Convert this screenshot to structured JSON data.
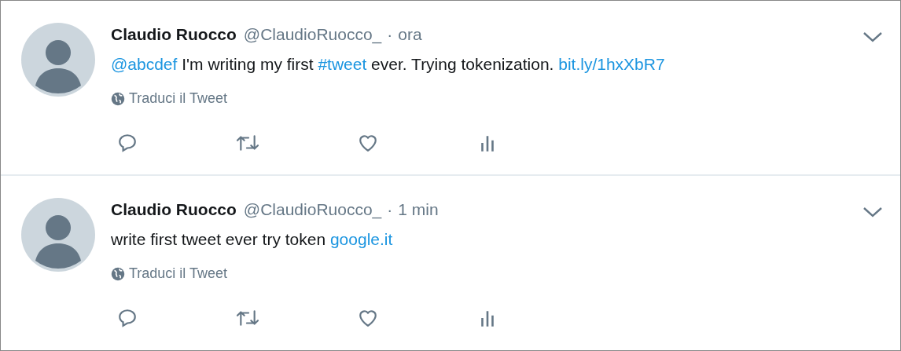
{
  "tweets": [
    {
      "name": "Claudio Ruocco",
      "handle": "@ClaudioRuocco_",
      "separator": "·",
      "time": "ora",
      "text": [
        {
          "kind": "link",
          "text": "@abcdef"
        },
        {
          "kind": "plain",
          "text": " I'm writing my first "
        },
        {
          "kind": "link",
          "text": "#tweet"
        },
        {
          "kind": "plain",
          "text": " ever. Trying tokenization. "
        },
        {
          "kind": "link",
          "text": "bit.ly/1hxXbR7"
        }
      ],
      "translate": "Traduci il Tweet"
    },
    {
      "name": "Claudio Ruocco",
      "handle": "@ClaudioRuocco_",
      "separator": "·",
      "time": "1 min",
      "text": [
        {
          "kind": "plain",
          "text": "write first tweet ever try token "
        },
        {
          "kind": "link",
          "text": "google.it"
        }
      ],
      "translate": "Traduci il Tweet"
    }
  ]
}
